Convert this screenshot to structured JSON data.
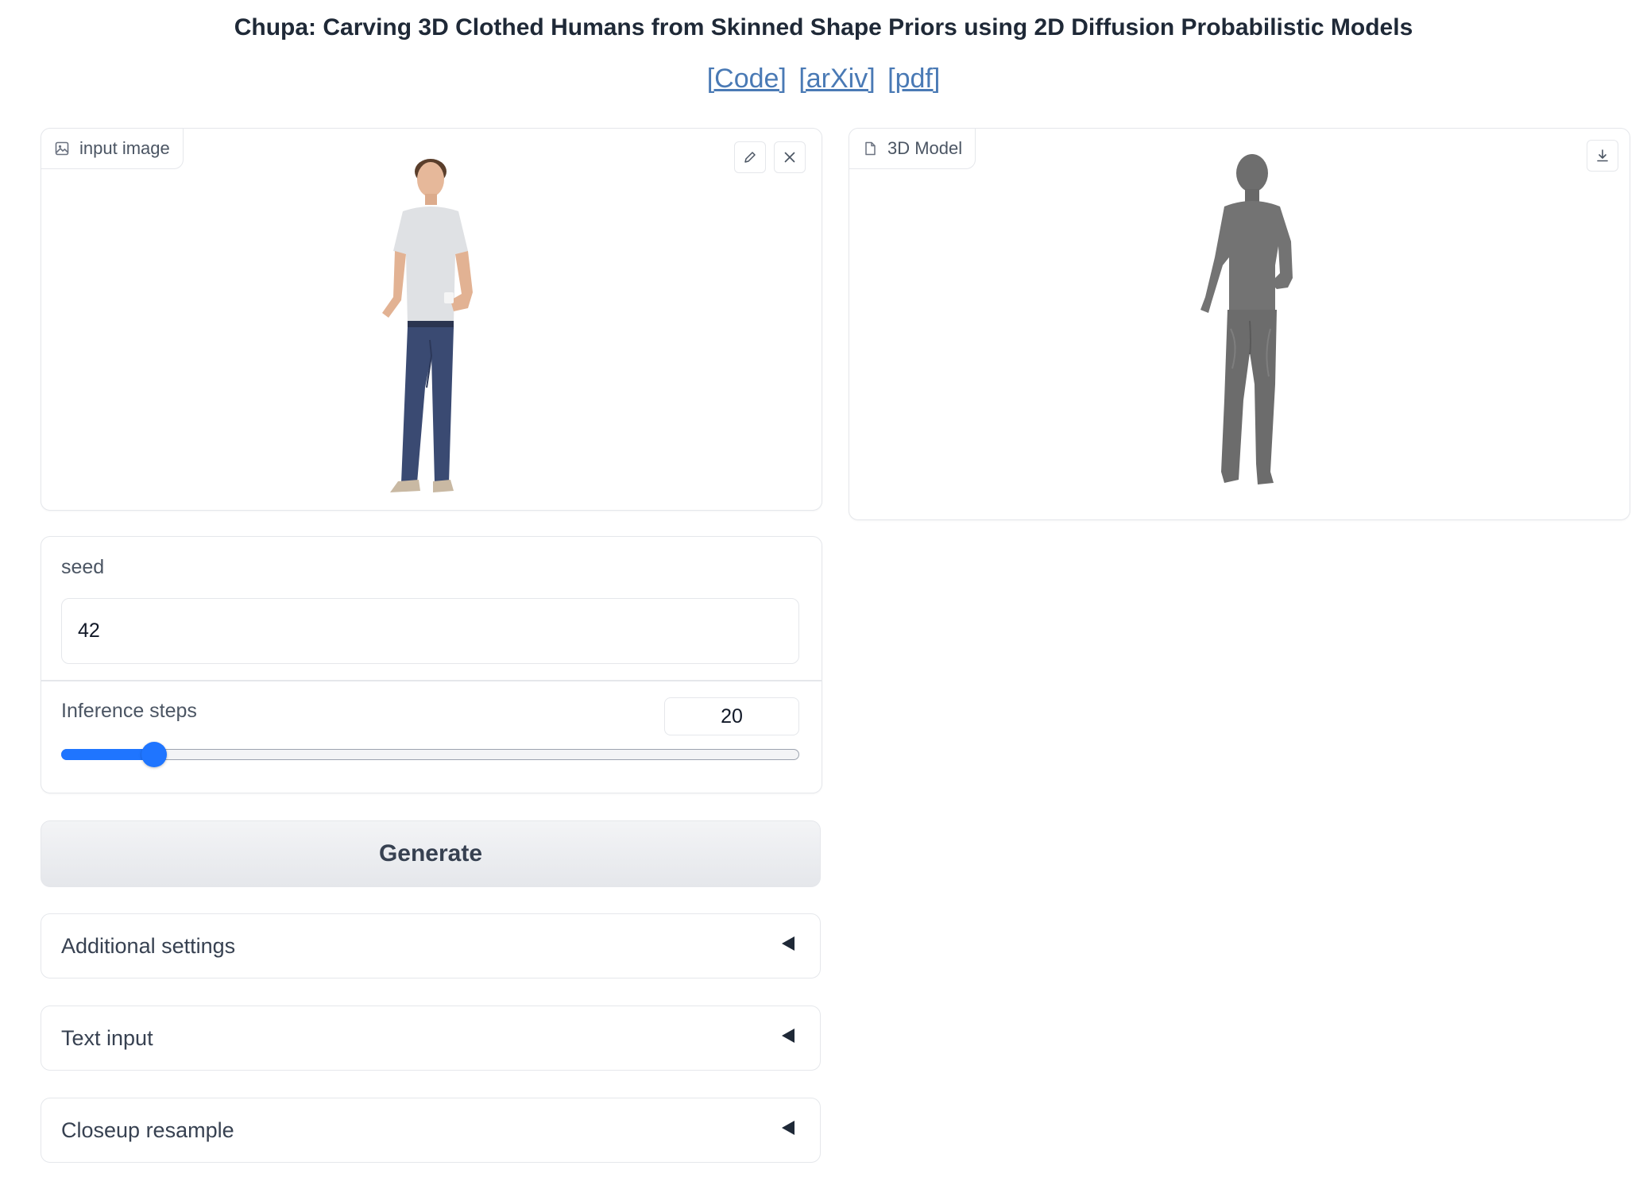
{
  "header": {
    "title": "Chupa: Carving 3D Clothed Humans from Skinned Shape Priors using 2D Diffusion Probabilistic Models",
    "links": [
      "[Code]",
      "[arXiv]",
      "[pdf]"
    ]
  },
  "input_image": {
    "label": "input image",
    "icon": "image-icon",
    "edit_icon": "pencil-icon",
    "clear_icon": "close-icon"
  },
  "model_output": {
    "label": "3D Model",
    "icon": "file-icon",
    "download_icon": "download-icon"
  },
  "seed": {
    "label": "seed",
    "value": "42"
  },
  "inference_steps": {
    "label": "Inference steps",
    "value": "20",
    "slider_fraction": 0.125
  },
  "generate_label": "Generate",
  "accordions": [
    {
      "label": "Additional settings"
    },
    {
      "label": "Text input"
    },
    {
      "label": "Closeup resample"
    }
  ],
  "colors": {
    "accent": "#1f75ff",
    "link": "#4a7ab5",
    "border": "#e5e7eb"
  }
}
